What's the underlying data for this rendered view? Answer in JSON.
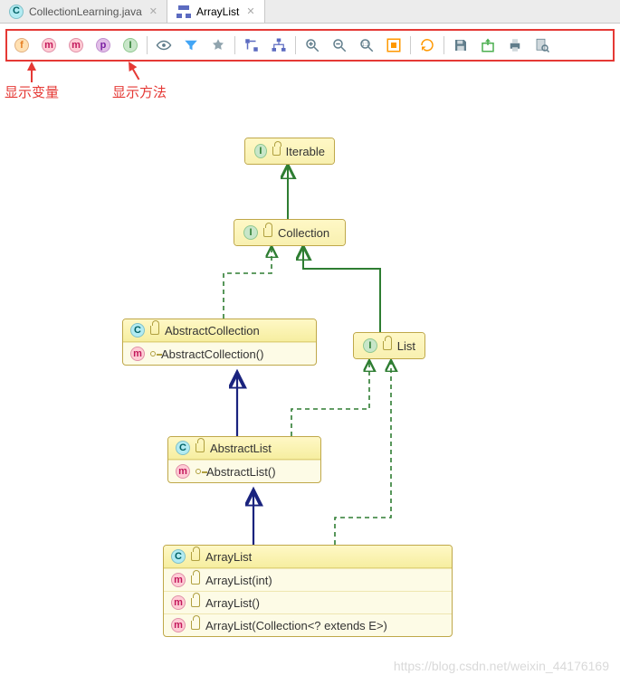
{
  "tabs": [
    {
      "icon": "c",
      "label": "CollectionLearning.java",
      "active": false
    },
    {
      "icon": "hier",
      "label": "ArrayList",
      "active": true
    }
  ],
  "toolbar": {
    "buttons": [
      {
        "kind": "badge",
        "letter": "f",
        "name": "show-fields-button"
      },
      {
        "kind": "badge",
        "letter": "m",
        "name": "show-constructors-button"
      },
      {
        "kind": "badge",
        "letter": "m",
        "name": "show-methods-button"
      },
      {
        "kind": "badge",
        "letter": "p",
        "name": "show-properties-button"
      },
      {
        "kind": "badge",
        "letter": "I",
        "name": "show-inner-classes-button"
      },
      {
        "kind": "sep"
      },
      {
        "kind": "svg",
        "svg": "eye",
        "name": "change-visibility-button"
      },
      {
        "kind": "svg",
        "svg": "filter",
        "name": "change-scope-button"
      },
      {
        "kind": "svg",
        "svg": "star",
        "name": "edit-node-button"
      },
      {
        "kind": "sep"
      },
      {
        "kind": "svg",
        "svg": "deps",
        "name": "show-dependencies-button"
      },
      {
        "kind": "svg",
        "svg": "layout",
        "name": "apply-layout-button"
      },
      {
        "kind": "sep"
      },
      {
        "kind": "svg",
        "svg": "zoomin",
        "name": "zoom-in-button"
      },
      {
        "kind": "svg",
        "svg": "zoomout",
        "name": "zoom-out-button"
      },
      {
        "kind": "svg",
        "svg": "zoom1",
        "name": "actual-size-button"
      },
      {
        "kind": "svg",
        "svg": "fit",
        "name": "fit-content-button"
      },
      {
        "kind": "sep"
      },
      {
        "kind": "svg",
        "svg": "refresh",
        "name": "refresh-button"
      },
      {
        "kind": "sep"
      },
      {
        "kind": "svg",
        "svg": "save",
        "name": "save-diagram-button"
      },
      {
        "kind": "svg",
        "svg": "export",
        "name": "export-image-button"
      },
      {
        "kind": "svg",
        "svg": "print",
        "name": "print-button"
      },
      {
        "kind": "svg",
        "svg": "preview",
        "name": "print-preview-button"
      }
    ]
  },
  "annotations": {
    "left": "显示变量",
    "right": "显示方法"
  },
  "diagram": {
    "nodes": {
      "iterable": {
        "kind": "interface",
        "title": "Iterable"
      },
      "collection": {
        "kind": "interface",
        "title": "Collection"
      },
      "list": {
        "kind": "interface",
        "title": "List"
      },
      "abstractCollection": {
        "kind": "class",
        "title": "AbstractCollection",
        "members": [
          {
            "icon": "m",
            "vis": "key",
            "label": "AbstractCollection()"
          }
        ]
      },
      "abstractList": {
        "kind": "class",
        "title": "AbstractList",
        "members": [
          {
            "icon": "m",
            "vis": "key",
            "label": "AbstractList()"
          }
        ]
      },
      "arrayList": {
        "kind": "class",
        "title": "ArrayList",
        "members": [
          {
            "icon": "m",
            "vis": "lock",
            "label": "ArrayList(int)"
          },
          {
            "icon": "m",
            "vis": "lock",
            "label": "ArrayList()"
          },
          {
            "icon": "m",
            "vis": "lock",
            "label": "ArrayList(Collection<? extends E>)"
          }
        ]
      }
    }
  },
  "watermark": "https://blog.csdn.net/weixin_44176169"
}
